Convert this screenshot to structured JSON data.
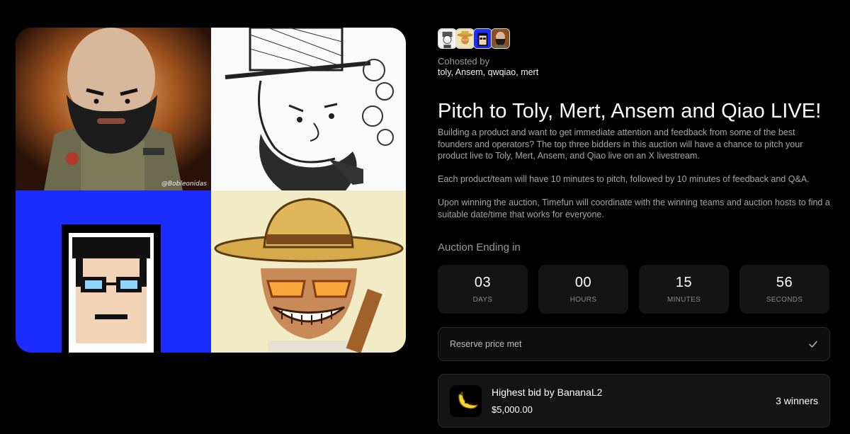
{
  "artwork": {
    "watermark": "@Bobleonidas"
  },
  "cohosts": {
    "avatars": [
      "toly-avatar",
      "ansem-avatar",
      "qwqiao-avatar",
      "mert-avatar"
    ],
    "label": "Cohosted by",
    "names": "toly, Ansem, qwqiao, mert"
  },
  "auction": {
    "title": "Pitch to Toly, Mert, Ansem and Qiao LIVE!",
    "description": [
      "Building a product and want to get immediate attention and feedback from some of the best founders and operators?  The top three bidders in this auction will have a chance to pitch your product live to Toly, Mert, Ansem, and Qiao live on an X livestream.",
      "Each product/team will have 10 minutes to pitch, followed by 10 minutes of feedback and Q&A.",
      "Upon winning the auction, Timefun will coordinate with the winning teams and auction hosts to find a suitable date/time that works for everyone."
    ],
    "ending_label": "Auction Ending in",
    "countdown": [
      {
        "value": "03",
        "unit": "DAYS"
      },
      {
        "value": "00",
        "unit": "HOURS"
      },
      {
        "value": "15",
        "unit": "MINUTES"
      },
      {
        "value": "56",
        "unit": "SECONDS"
      }
    ],
    "reserve": {
      "label": "Reserve price met",
      "icon": "check-icon"
    },
    "highest_bid": {
      "avatar_icon": "banana-icon",
      "title": "Highest bid by BananaL2",
      "amount": "$5,000.00",
      "winners": "3 winners"
    }
  },
  "colors": {
    "background": "#000000",
    "card": "#141414",
    "muted_text": "#a6a6a6",
    "pixel_blue": "#1a2cff"
  }
}
